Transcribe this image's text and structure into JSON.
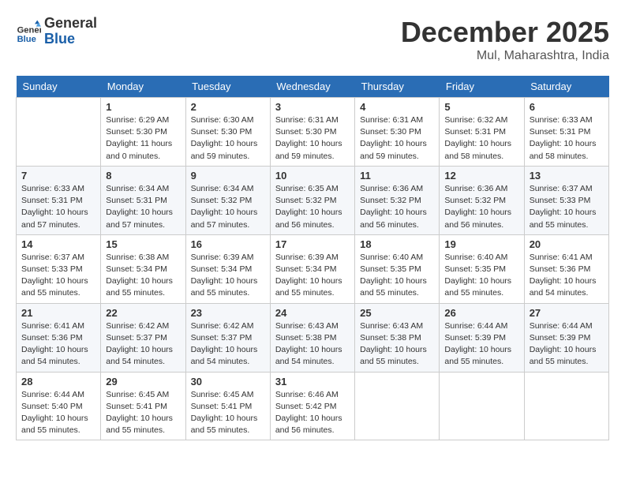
{
  "header": {
    "logo_line1": "General",
    "logo_line2": "Blue",
    "month": "December 2025",
    "location": "Mul, Maharashtra, India"
  },
  "weekdays": [
    "Sunday",
    "Monday",
    "Tuesday",
    "Wednesday",
    "Thursday",
    "Friday",
    "Saturday"
  ],
  "weeks": [
    [
      {
        "day": "",
        "info": ""
      },
      {
        "day": "1",
        "info": "Sunrise: 6:29 AM\nSunset: 5:30 PM\nDaylight: 11 hours\nand 0 minutes."
      },
      {
        "day": "2",
        "info": "Sunrise: 6:30 AM\nSunset: 5:30 PM\nDaylight: 10 hours\nand 59 minutes."
      },
      {
        "day": "3",
        "info": "Sunrise: 6:31 AM\nSunset: 5:30 PM\nDaylight: 10 hours\nand 59 minutes."
      },
      {
        "day": "4",
        "info": "Sunrise: 6:31 AM\nSunset: 5:30 PM\nDaylight: 10 hours\nand 59 minutes."
      },
      {
        "day": "5",
        "info": "Sunrise: 6:32 AM\nSunset: 5:31 PM\nDaylight: 10 hours\nand 58 minutes."
      },
      {
        "day": "6",
        "info": "Sunrise: 6:33 AM\nSunset: 5:31 PM\nDaylight: 10 hours\nand 58 minutes."
      }
    ],
    [
      {
        "day": "7",
        "info": "Sunrise: 6:33 AM\nSunset: 5:31 PM\nDaylight: 10 hours\nand 57 minutes."
      },
      {
        "day": "8",
        "info": "Sunrise: 6:34 AM\nSunset: 5:31 PM\nDaylight: 10 hours\nand 57 minutes."
      },
      {
        "day": "9",
        "info": "Sunrise: 6:34 AM\nSunset: 5:32 PM\nDaylight: 10 hours\nand 57 minutes."
      },
      {
        "day": "10",
        "info": "Sunrise: 6:35 AM\nSunset: 5:32 PM\nDaylight: 10 hours\nand 56 minutes."
      },
      {
        "day": "11",
        "info": "Sunrise: 6:36 AM\nSunset: 5:32 PM\nDaylight: 10 hours\nand 56 minutes."
      },
      {
        "day": "12",
        "info": "Sunrise: 6:36 AM\nSunset: 5:32 PM\nDaylight: 10 hours\nand 56 minutes."
      },
      {
        "day": "13",
        "info": "Sunrise: 6:37 AM\nSunset: 5:33 PM\nDaylight: 10 hours\nand 55 minutes."
      }
    ],
    [
      {
        "day": "14",
        "info": "Sunrise: 6:37 AM\nSunset: 5:33 PM\nDaylight: 10 hours\nand 55 minutes."
      },
      {
        "day": "15",
        "info": "Sunrise: 6:38 AM\nSunset: 5:34 PM\nDaylight: 10 hours\nand 55 minutes."
      },
      {
        "day": "16",
        "info": "Sunrise: 6:39 AM\nSunset: 5:34 PM\nDaylight: 10 hours\nand 55 minutes."
      },
      {
        "day": "17",
        "info": "Sunrise: 6:39 AM\nSunset: 5:34 PM\nDaylight: 10 hours\nand 55 minutes."
      },
      {
        "day": "18",
        "info": "Sunrise: 6:40 AM\nSunset: 5:35 PM\nDaylight: 10 hours\nand 55 minutes."
      },
      {
        "day": "19",
        "info": "Sunrise: 6:40 AM\nSunset: 5:35 PM\nDaylight: 10 hours\nand 55 minutes."
      },
      {
        "day": "20",
        "info": "Sunrise: 6:41 AM\nSunset: 5:36 PM\nDaylight: 10 hours\nand 54 minutes."
      }
    ],
    [
      {
        "day": "21",
        "info": "Sunrise: 6:41 AM\nSunset: 5:36 PM\nDaylight: 10 hours\nand 54 minutes."
      },
      {
        "day": "22",
        "info": "Sunrise: 6:42 AM\nSunset: 5:37 PM\nDaylight: 10 hours\nand 54 minutes."
      },
      {
        "day": "23",
        "info": "Sunrise: 6:42 AM\nSunset: 5:37 PM\nDaylight: 10 hours\nand 54 minutes."
      },
      {
        "day": "24",
        "info": "Sunrise: 6:43 AM\nSunset: 5:38 PM\nDaylight: 10 hours\nand 54 minutes."
      },
      {
        "day": "25",
        "info": "Sunrise: 6:43 AM\nSunset: 5:38 PM\nDaylight: 10 hours\nand 55 minutes."
      },
      {
        "day": "26",
        "info": "Sunrise: 6:44 AM\nSunset: 5:39 PM\nDaylight: 10 hours\nand 55 minutes."
      },
      {
        "day": "27",
        "info": "Sunrise: 6:44 AM\nSunset: 5:39 PM\nDaylight: 10 hours\nand 55 minutes."
      }
    ],
    [
      {
        "day": "28",
        "info": "Sunrise: 6:44 AM\nSunset: 5:40 PM\nDaylight: 10 hours\nand 55 minutes."
      },
      {
        "day": "29",
        "info": "Sunrise: 6:45 AM\nSunset: 5:41 PM\nDaylight: 10 hours\nand 55 minutes."
      },
      {
        "day": "30",
        "info": "Sunrise: 6:45 AM\nSunset: 5:41 PM\nDaylight: 10 hours\nand 55 minutes."
      },
      {
        "day": "31",
        "info": "Sunrise: 6:46 AM\nSunset: 5:42 PM\nDaylight: 10 hours\nand 56 minutes."
      },
      {
        "day": "",
        "info": ""
      },
      {
        "day": "",
        "info": ""
      },
      {
        "day": "",
        "info": ""
      }
    ]
  ]
}
